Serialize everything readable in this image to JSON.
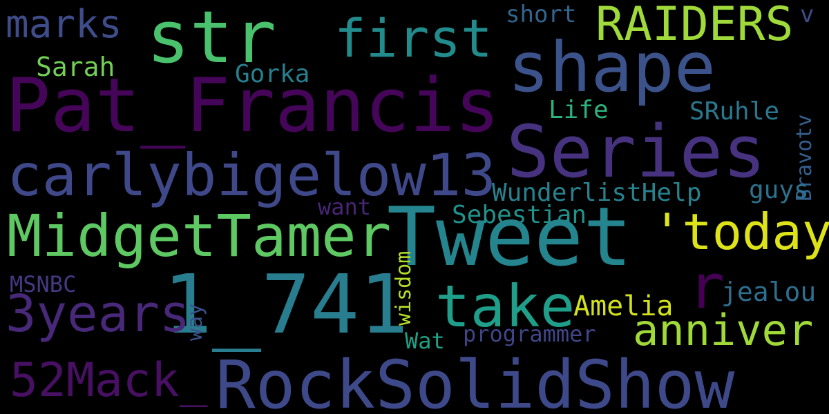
{
  "background": "#000000",
  "colormap": "viridis",
  "words": [
    {
      "id": "str",
      "text": "str",
      "color": "#4ac16d"
    },
    {
      "id": "marks",
      "text": "marks",
      "color": "#3e4c8a"
    },
    {
      "id": "first",
      "text": "first",
      "color": "#228c8d"
    },
    {
      "id": "raiders",
      "text": "RAIDERS",
      "color": "#9fda3a"
    },
    {
      "id": "short",
      "text": "short",
      "color": "#32658e"
    },
    {
      "id": "v",
      "text": "v",
      "color": "#3e4c8a"
    },
    {
      "id": "shape",
      "text": "shape",
      "color": "#3b528b"
    },
    {
      "id": "sarah",
      "text": "Sarah",
      "color": "#74d055"
    },
    {
      "id": "gorka",
      "text": "Gorka",
      "color": "#277f8e"
    },
    {
      "id": "pat-francis",
      "text": "Pat_Francis",
      "color": "#450559"
    },
    {
      "id": "life",
      "text": "Life",
      "color": "#2db27d"
    },
    {
      "id": "sruhle",
      "text": "SRuhle",
      "color": "#2a788e"
    },
    {
      "id": "series",
      "text": "Series",
      "color": "#46327e"
    },
    {
      "id": "bravotv",
      "text": "Bravotv",
      "color": "#355f8d"
    },
    {
      "id": "carlybigelow13",
      "text": "carlybigelow13",
      "color": "#3f4889"
    },
    {
      "id": "wunderlisthelp",
      "text": "WunderlistHelp",
      "color": "#26828e"
    },
    {
      "id": "guys",
      "text": "guys",
      "color": "#2c728e"
    },
    {
      "id": "want",
      "text": "want",
      "color": "#482576"
    },
    {
      "id": "sebestian",
      "text": "Sebestian",
      "color": "#21918c"
    },
    {
      "id": "midgettamer",
      "text": "MidgetTamer",
      "color": "#5ec962"
    },
    {
      "id": "tweet",
      "text": "Tweet",
      "color": "#25858e"
    },
    {
      "id": "quote-today",
      "text": "'today",
      "color": "#dde318"
    },
    {
      "id": "wisdom",
      "text": "wisdom",
      "color": "#b5de2b"
    },
    {
      "id": "msnbc",
      "text": "MSNBC",
      "color": "#443983"
    },
    {
      "id": "r",
      "text": "r",
      "color": "#440154"
    },
    {
      "id": "jealou",
      "text": "jealou",
      "color": "#2e6e8e"
    },
    {
      "id": "n-1741",
      "text": "1_741",
      "color": "#287d8e"
    },
    {
      "id": "take",
      "text": "take",
      "color": "#1f9e89"
    },
    {
      "id": "amelia",
      "text": "Amelia",
      "color": "#d2e21b"
    },
    {
      "id": "3years",
      "text": "3years",
      "color": "#482878"
    },
    {
      "id": "way",
      "text": "way",
      "color": "#3b528b"
    },
    {
      "id": "anniver",
      "text": "anniver",
      "color": "#a0da39"
    },
    {
      "id": "wat",
      "text": "Wat",
      "color": "#1fa187"
    },
    {
      "id": "programmer",
      "text": "programmer",
      "color": "#404688"
    },
    {
      "id": "52mack",
      "text": "52Mack_",
      "color": "#471063"
    },
    {
      "id": "rocksolidshow",
      "text": "RockSolidShow",
      "color": "#3e4989"
    }
  ]
}
